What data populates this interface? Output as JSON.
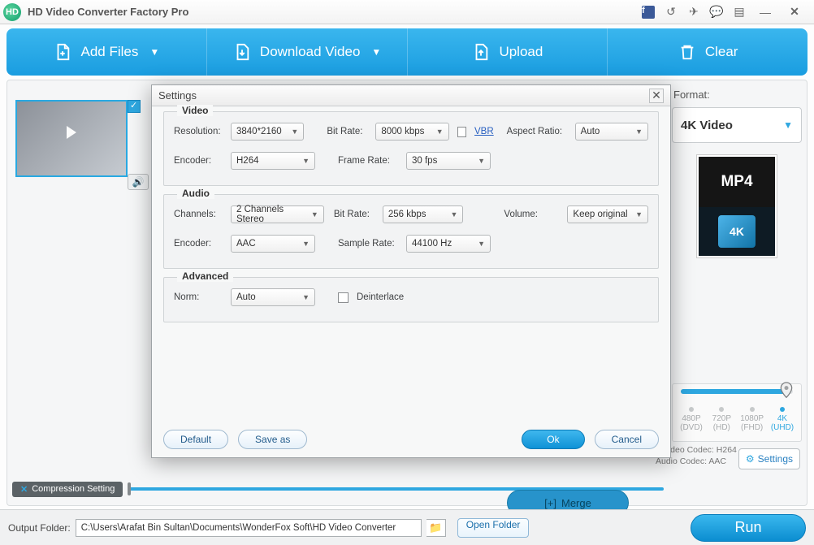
{
  "titlebar": {
    "title": "HD Video Converter Factory Pro"
  },
  "toolbar": {
    "add_files": "Add Files",
    "download_video": "Download Video",
    "upload": "Upload",
    "clear": "Clear"
  },
  "format_panel": {
    "label": "Format:",
    "selected": "4K Video",
    "mp4_label": "MP4",
    "fourk_label": "4K"
  },
  "quality": {
    "options": [
      {
        "res": "480P",
        "sub": "(DVD)"
      },
      {
        "res": "720P",
        "sub": "(HD)"
      },
      {
        "res": "1080P",
        "sub": "(FHD)"
      },
      {
        "res": "4K",
        "sub": "(UHD)"
      }
    ],
    "selected_index": 3
  },
  "codec": {
    "video_label": "Video Codec:",
    "video_value": "H264",
    "audio_label": "Audio Codec:",
    "audio_value": "AAC"
  },
  "settings_btn": "Settings",
  "compression": {
    "label": "Compression Setting"
  },
  "merge": "Merge",
  "bottom": {
    "output_label": "Output Folder:",
    "path": "C:\\Users\\Arafat Bin Sultan\\Documents\\WonderFox Soft\\HD Video Converter",
    "open_folder": "Open Folder",
    "run": "Run"
  },
  "dialog": {
    "title": "Settings",
    "video": {
      "legend": "Video",
      "resolution_label": "Resolution:",
      "resolution": "3840*2160",
      "bitrate_label": "Bit Rate:",
      "bitrate": "8000 kbps",
      "vbr": "VBR",
      "aspect_label": "Aspect Ratio:",
      "aspect": "Auto",
      "encoder_label": "Encoder:",
      "encoder": "H264",
      "framerate_label": "Frame Rate:",
      "framerate": "30 fps"
    },
    "audio": {
      "legend": "Audio",
      "channels_label": "Channels:",
      "channels": "2 Channels Stereo",
      "bitrate_label": "Bit Rate:",
      "bitrate": "256 kbps",
      "volume_label": "Volume:",
      "volume": "Keep original",
      "encoder_label": "Encoder:",
      "encoder": "AAC",
      "samplerate_label": "Sample Rate:",
      "samplerate": "44100 Hz"
    },
    "advanced": {
      "legend": "Advanced",
      "norm_label": "Norm:",
      "norm": "Auto",
      "deinterlace": "Deinterlace"
    },
    "buttons": {
      "default": "Default",
      "saveas": "Save as",
      "ok": "Ok",
      "cancel": "Cancel"
    }
  }
}
